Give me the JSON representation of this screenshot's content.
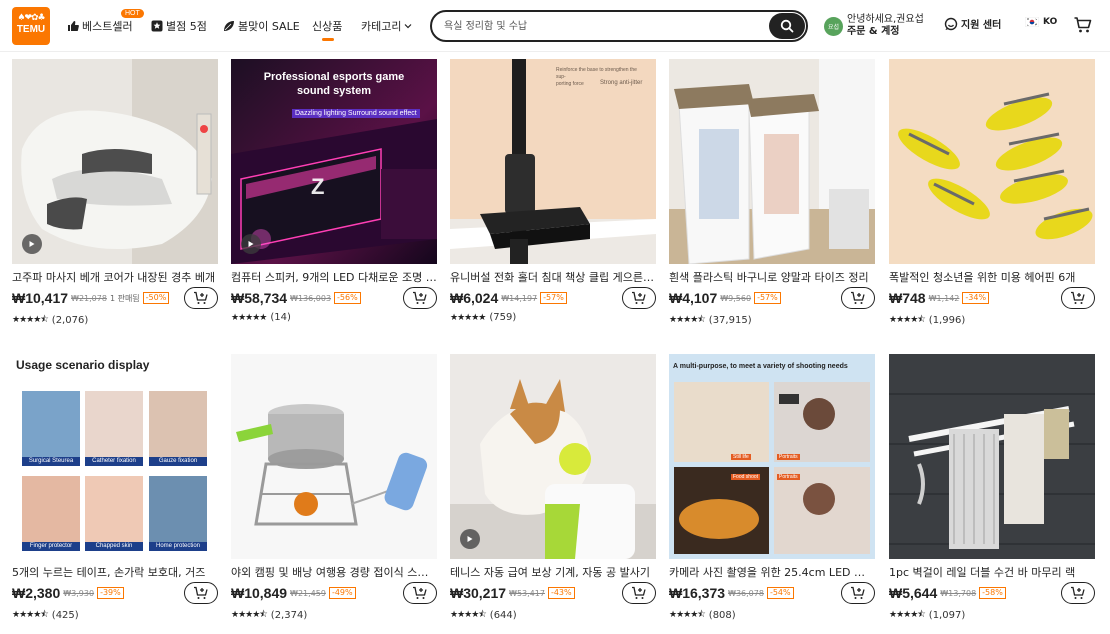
{
  "header": {
    "logo_text": "TEMU",
    "logo_icons": "♠❤✿♣",
    "nav": [
      {
        "label": "베스트셀러",
        "icon": "thumbs-up-icon"
      },
      {
        "label": "별점 5점",
        "icon": "star-badge-icon"
      },
      {
        "label": "봄맞이 SALE",
        "icon": "leaf-icon"
      },
      {
        "label": "신상품",
        "icon": "",
        "active": true
      },
      {
        "label": "카테고리",
        "icon": "chevron-down-icon"
      }
    ],
    "hot_badge": "HOT",
    "search_placeholder": "욕실 정리함 및 수납",
    "account_avatar": "요섭",
    "account_greeting": "안녕하세요,권요섭",
    "account_link": "주문 & 계정",
    "support": "지원 센터",
    "lang": "KO",
    "accent_color": "#fb7701"
  },
  "products": [
    {
      "title": "고주파 마사지 베개 코어가 내장된 경추 베개",
      "price": "₩10,417",
      "orig": "₩21,078",
      "sold": "1 판매됨",
      "disc": "-50%",
      "reviews": "(2,076)",
      "rating": 4.5,
      "video": true
    },
    {
      "title": "컴퓨터 스피커, 9개의 LED 다채로운 조명 효과",
      "price": "₩58,734",
      "orig": "₩136,003",
      "sold": "",
      "disc": "-56%",
      "reviews": "(14)",
      "rating": 5,
      "video": true,
      "img_text_1": "Professional esports game",
      "img_text_2": "sound system",
      "img_text_3": "Dazzling lighting Surround sound effect"
    },
    {
      "title": "유니버설 전화 홀더 침대 책상 클립 게으른 브래킷",
      "price": "₩6,024",
      "orig": "₩14,197",
      "sold": "",
      "disc": "-57%",
      "reviews": "(759)",
      "rating": 5,
      "video": false,
      "img_text_1": "Reinforce the base to strengthen the sup-",
      "img_text_2": "porting force",
      "img_text_3": "Strong anti-jitter"
    },
    {
      "title": "흰색 플라스틱 바구니로 양말과 타이즈 정리",
      "price": "₩4,107",
      "orig": "₩9,560",
      "sold": "",
      "disc": "-57%",
      "reviews": "(37,915)",
      "rating": 4.5,
      "video": false
    },
    {
      "title": "폭발적인 청소년을 위한 미용 헤어핀 6개",
      "price": "₩748",
      "orig": "₩1,142",
      "sold": "",
      "disc": "-34%",
      "reviews": "(1,996)",
      "rating": 4.5,
      "video": false
    },
    {
      "title": "5개의 누르는 테이프, 손가락 보호대, 거즈",
      "price": "₩2,380",
      "orig": "₩3,930",
      "sold": "",
      "disc": "-39%",
      "reviews": "(425)",
      "rating": 4.5,
      "video": false,
      "img_text_1": "Usage scenario display",
      "img_labels": [
        "Surgical Steurea",
        "Catheter fixation",
        "Gauze fixation",
        "Finger protector",
        "Chapped skin",
        "Home protection"
      ]
    },
    {
      "title": "야외 캠핑 및 배낭 여행용 경량 접이식 스토브",
      "price": "₩10,849",
      "orig": "₩21,459",
      "sold": "",
      "disc": "-49%",
      "reviews": "(2,374)",
      "rating": 4.5,
      "video": false
    },
    {
      "title": "테니스 자동 급여 보상 기계, 자동 공 발사기",
      "price": "₩30,217",
      "orig": "₩53,417",
      "sold": "",
      "disc": "-43%",
      "reviews": "(644)",
      "rating": 4.5,
      "video": true
    },
    {
      "title": "카메라 사진 촬영을 위한 25.4cm LED 링 라이트",
      "price": "₩16,373",
      "orig": "₩36,078",
      "sold": "",
      "disc": "-54%",
      "reviews": "(808)",
      "rating": 4.5,
      "video": false,
      "img_text_1": "A multi-purpose, to meet a variety of shooting needs",
      "img_labels": [
        "Still life",
        "Portraits",
        "Food shoot",
        "Portraits"
      ]
    },
    {
      "title": "1pc 벽걸이 레일 더블 수건 바 마무리 랙",
      "price": "₩5,644",
      "orig": "₩13,708",
      "sold": "",
      "disc": "-58%",
      "reviews": "(1,097)",
      "rating": 4.5,
      "video": false
    }
  ]
}
